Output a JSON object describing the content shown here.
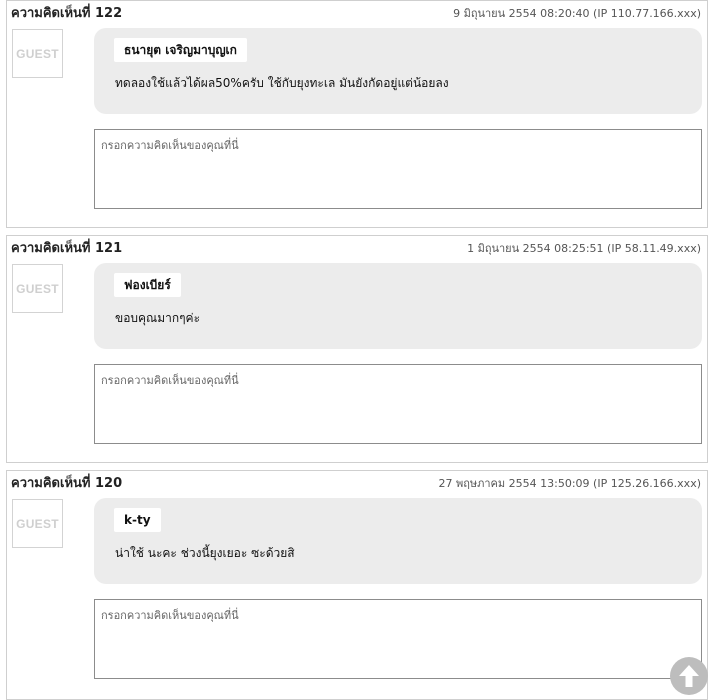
{
  "comments": [
    {
      "number_label": "ความคิดเห็นที่ 122",
      "meta": "9 มิถุนายน 2554 08:20:40 (IP 110.77.166.xxx)",
      "avatar_label": "GUEST",
      "author": "ธนายุต เจริญมาบุญเก",
      "text": "ทดลองใช้แล้วได้ผล50%ครับ ใช้กับยุงทะเล มันยังกัดอยู่แต่น้อยลง",
      "reply_placeholder": "กรอกความคิดเห็นของคุณที่นี่"
    },
    {
      "number_label": "ความคิดเห็นที่ 121",
      "meta": "1 มิถุนายน 2554 08:25:51 (IP 58.11.49.xxx)",
      "avatar_label": "GUEST",
      "author": "ฟองเบียร์",
      "text": "ขอบคุณมากๆค่ะ",
      "reply_placeholder": "กรอกความคิดเห็นของคุณที่นี่"
    },
    {
      "number_label": "ความคิดเห็นที่ 120",
      "meta": "27 พฤษภาคม 2554 13:50:09 (IP 125.26.166.xxx)",
      "avatar_label": "GUEST",
      "author": "k-ty",
      "text": "น่าใช้ นะคะ ช่วงนี้ยุงเยอะ ซะด้วยสิ",
      "reply_placeholder": "กรอกความคิดเห็นของคุณที่นี่"
    }
  ],
  "scroll_top_icon": "arrow-up-circle-icon",
  "colors": {
    "bubble": "#ececec",
    "border": "#cfcfcf",
    "avatar_text": "#cfcfcf",
    "scroll_button": "#bdbdbd"
  }
}
